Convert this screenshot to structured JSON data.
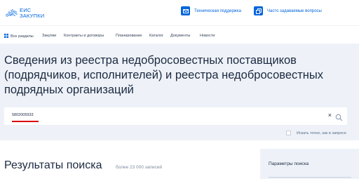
{
  "logo": {
    "line1": "ЕИС",
    "line2": "ЗАКУПКИ",
    "icon": "russia-map-icon"
  },
  "header_links": [
    {
      "label": "Техническая поддержка",
      "icon": "mail-icon"
    },
    {
      "label": "Часто задаваемые вопросы",
      "icon": "copy-icon"
    }
  ],
  "nav": {
    "all_sections": "Все разделы",
    "items": [
      "Закупки",
      "Контракты и договоры",
      "Планирование",
      "Каталог",
      "Документы",
      "Новости"
    ]
  },
  "page": {
    "title_lines": [
      "Сведения из реестра недобросовестных поставщиков",
      "(подрядчиков, исполнителей) и реестра недобросовестных",
      "подрядных организаций"
    ]
  },
  "search": {
    "value": "5802005933",
    "exact_label": "Искать точно, как в запросе"
  },
  "results": {
    "title": "Результаты поиска",
    "count": "более 23 000 записей"
  },
  "params": {
    "title": "Параметры поиска"
  },
  "colors": {
    "brand": "#0065dd",
    "hero_bg": "#eef2f8",
    "accent_red": "#d90000"
  }
}
